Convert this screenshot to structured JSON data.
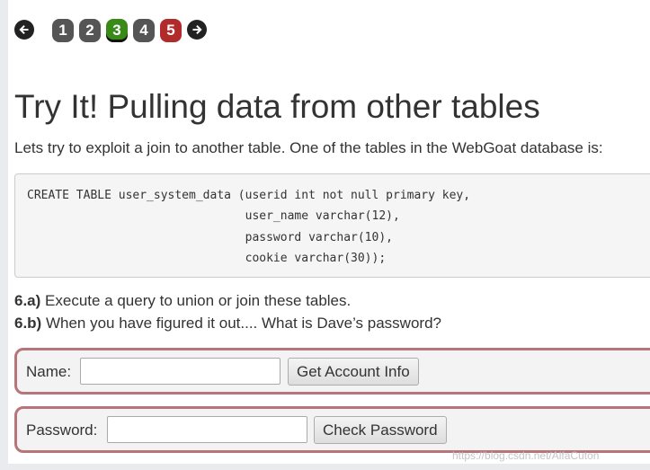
{
  "pagination": {
    "prev_icon": "arrow-left-icon",
    "next_icon": "arrow-right-icon",
    "pages": [
      {
        "label": "1",
        "state": "complete",
        "color": "#555555"
      },
      {
        "label": "2",
        "state": "complete",
        "color": "#555555"
      },
      {
        "label": "3",
        "state": "current",
        "color": "#3a8a1a"
      },
      {
        "label": "4",
        "state": "complete",
        "color": "#555555"
      },
      {
        "label": "5",
        "state": "incomplete",
        "color": "#b22b2b"
      }
    ]
  },
  "lesson": {
    "title": "Try It! Pulling data from other tables",
    "intro": "Lets try to exploit a join to another table. One of the tables in the WebGoat database is:",
    "code": "CREATE TABLE user_system_data (userid int not null primary key,\n                               user_name varchar(12),\n                               password varchar(10),\n                               cookie varchar(30));",
    "tasks": [
      {
        "label": "6.a)",
        "text": " Execute a query to union or join these tables."
      },
      {
        "label": "6.b)",
        "text": " When you have figured it out.... What is Dave’s password?"
      }
    ]
  },
  "forms": {
    "name_form": {
      "label": "Name:",
      "value": "",
      "button": "Get Account Info"
    },
    "password_form": {
      "label": "Password:",
      "value": "",
      "button": "Check Password"
    }
  },
  "watermark": "https://blog.csdn.net/AlfaCuton",
  "colors": {
    "form_border": "#b5757a",
    "current_page": "#3a8a1a",
    "failed_page": "#b22b2b"
  }
}
